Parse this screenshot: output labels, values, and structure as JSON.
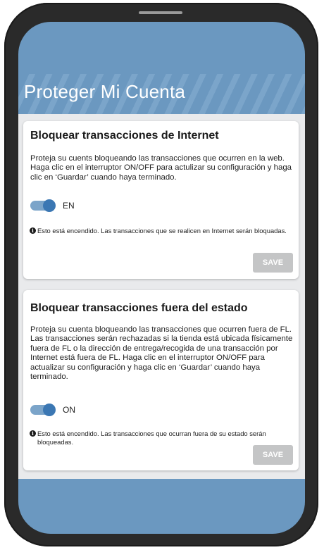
{
  "header": {
    "title": "Proteger Mi Cuenta"
  },
  "colors": {
    "brand_blue": "#6b98c0",
    "toggle_on": "#3b77b3",
    "save_disabled": "#c4c5c6",
    "content_bg": "#e9eaec"
  },
  "cards": [
    {
      "title": "Bloquear transacciones de Internet",
      "description": "Proteja su cuents bloqueando las transacciones que ocurren en la web. Haga clic en el interruptor ON/OFF para actulizar su configuración y haga clic en ‘Guardar’ cuando haya terminado.",
      "toggle": {
        "state": true,
        "label": "EN"
      },
      "notice": "Esto está encendido. Las transacciones que se realicen en Internet serán bloquadas.",
      "save_label": "SAVE"
    },
    {
      "title": "Bloquear transacciones fuera del estado",
      "description": "Proteja su cuenta bloqueando las transacciones que ocurren fuera de FL. Las transacciones serán rechazadas si la tienda está ubicada físicamente fuera de FL o la dirección de entrega/recogida de una transacción por Internet está fuera de FL. Haga clic en el interruptor ON/OFF para actualizar su configuración y haga clic en ‘Guardar’ cuando haya terminado.",
      "toggle": {
        "state": true,
        "label": "ON"
      },
      "notice": "Esto está encendido. Las transacciones que ocurran fuera de su estado serán bloqueadas.",
      "save_label": "SAVE"
    }
  ]
}
